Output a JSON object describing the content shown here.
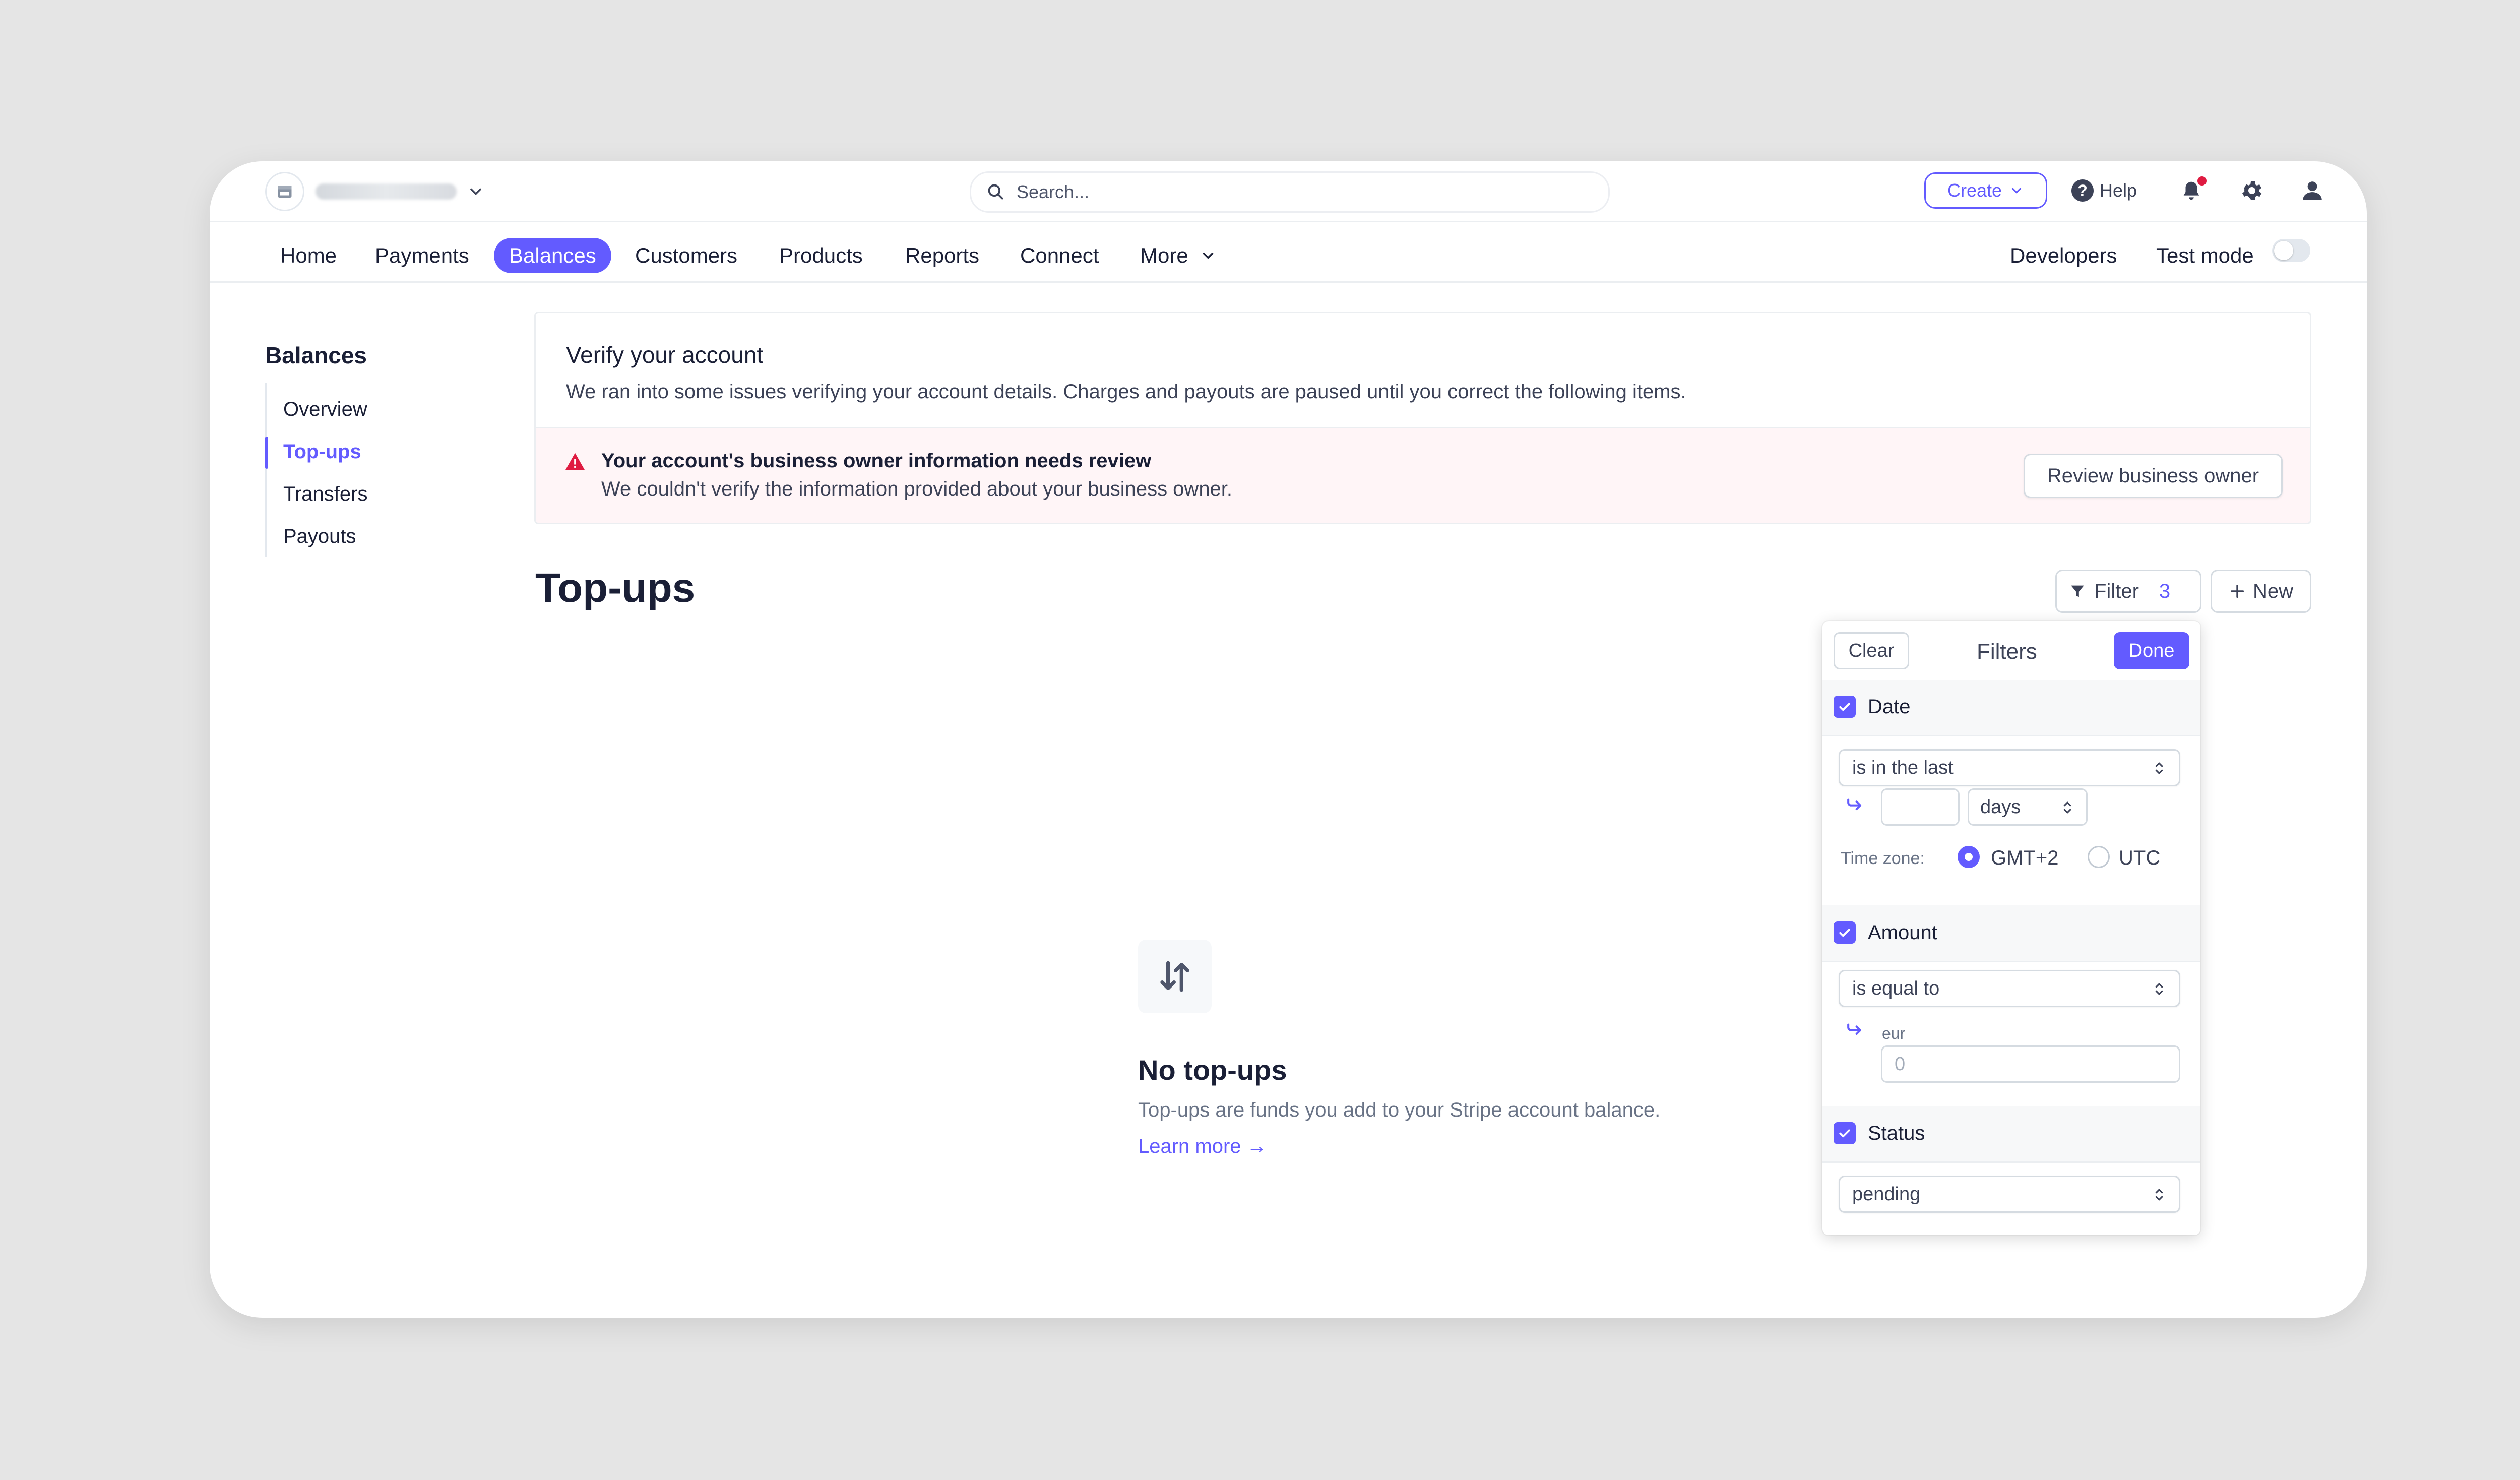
{
  "topbar": {
    "search_placeholder": "Search...",
    "create_label": "Create",
    "help_label": "Help"
  },
  "nav": {
    "items": [
      {
        "label": "Home"
      },
      {
        "label": "Payments"
      },
      {
        "label": "Balances",
        "active": true
      },
      {
        "label": "Customers"
      },
      {
        "label": "Products"
      },
      {
        "label": "Reports"
      },
      {
        "label": "Connect"
      },
      {
        "label": "More"
      }
    ],
    "developers_label": "Developers",
    "test_mode_label": "Test mode",
    "test_mode_on": false
  },
  "sidebar": {
    "title": "Balances",
    "items": [
      {
        "label": "Overview"
      },
      {
        "label": "Top-ups",
        "active": true
      },
      {
        "label": "Transfers"
      },
      {
        "label": "Payouts"
      }
    ]
  },
  "verify": {
    "title": "Verify your account",
    "description": "We ran into some issues verifying your account details. Charges and payouts are paused until you correct the following items.",
    "alert_title": "Your account's business owner information needs review",
    "alert_description": "We couldn't verify the information provided about your business owner.",
    "review_button": "Review business owner"
  },
  "main": {
    "title": "Top-ups",
    "filter_label": "Filter",
    "filter_count": "3",
    "new_label": "New"
  },
  "empty": {
    "title": "No top-ups",
    "description": "Top-ups are funds you add to your Stripe account balance.",
    "learn_more": "Learn more →"
  },
  "filters": {
    "clear_label": "Clear",
    "title": "Filters",
    "done_label": "Done",
    "date": {
      "label": "Date",
      "checked": true,
      "operator": "is in the last",
      "value": "",
      "unit": "days",
      "timezone_label": "Time zone:",
      "timezones": [
        "GMT+2",
        "UTC"
      ],
      "selected_timezone": "GMT+2"
    },
    "amount": {
      "label": "Amount",
      "checked": true,
      "operator": "is equal to",
      "currency": "eur",
      "placeholder": "0"
    },
    "status": {
      "label": "Status",
      "checked": true,
      "value": "pending"
    }
  },
  "colors": {
    "accent": "#635bff",
    "alert_bg": "#fff5f7",
    "danger": "#df1b41"
  }
}
